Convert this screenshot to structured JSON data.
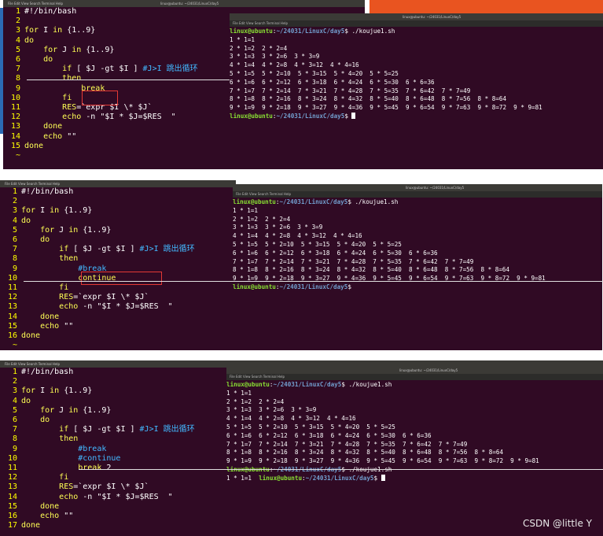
{
  "window": {
    "menu_items": [
      "File",
      "Edit",
      "View",
      "Search",
      "Terminal",
      "Help"
    ],
    "terminal_title": "linux@ubuntu: ~/24031/LinuxC/day5"
  },
  "panels": [
    {
      "lines": [
        {
          "n": "1",
          "parts": [
            {
              "c": "tx",
              "t": "#!/bin/bash"
            }
          ]
        },
        {
          "n": "2",
          "parts": []
        },
        {
          "n": "3",
          "parts": [
            {
              "c": "kw",
              "t": "for"
            },
            {
              "c": "tx",
              "t": " I "
            },
            {
              "c": "kw",
              "t": "in"
            },
            {
              "c": "tx",
              "t": " {1..9}"
            }
          ]
        },
        {
          "n": "4",
          "parts": [
            {
              "c": "kw",
              "t": "do"
            }
          ]
        },
        {
          "n": "5",
          "parts": [
            {
              "c": "tx",
              "t": "    "
            },
            {
              "c": "kw",
              "t": "for"
            },
            {
              "c": "tx",
              "t": " J "
            },
            {
              "c": "kw",
              "t": "in"
            },
            {
              "c": "tx",
              "t": " {1..9}"
            }
          ]
        },
        {
          "n": "6",
          "parts": [
            {
              "c": "tx",
              "t": "    "
            },
            {
              "c": "kw",
              "t": "do"
            }
          ]
        },
        {
          "n": "7",
          "parts": [
            {
              "c": "tx",
              "t": "        "
            },
            {
              "c": "kw",
              "t": "if"
            },
            {
              "c": "tx",
              "t": " [ $J -gt $I ] "
            },
            {
              "c": "cm",
              "t": "#J>I 跳出循环"
            }
          ]
        },
        {
          "n": "8",
          "parts": [
            {
              "c": "tx",
              "t": "        "
            },
            {
              "c": "kw",
              "t": "then"
            }
          ]
        },
        {
          "n": "9",
          "parts": [
            {
              "c": "tx",
              "t": "            "
            },
            {
              "c": "kw",
              "t": "break"
            }
          ]
        },
        {
          "n": "10",
          "parts": [
            {
              "c": "tx",
              "t": "        "
            },
            {
              "c": "kw",
              "t": "fi"
            }
          ]
        },
        {
          "n": "11",
          "parts": [
            {
              "c": "tx",
              "t": "        "
            },
            {
              "c": "kw",
              "t": "RES"
            },
            {
              "c": "tx",
              "t": "=`expr $I \\* $J`"
            }
          ]
        },
        {
          "n": "12",
          "parts": [
            {
              "c": "tx",
              "t": "        "
            },
            {
              "c": "kw",
              "t": "echo"
            },
            {
              "c": "tx",
              "t": " -n \"$I * $J=$RES  \""
            }
          ]
        },
        {
          "n": "13",
          "parts": [
            {
              "c": "tx",
              "t": "    "
            },
            {
              "c": "kw",
              "t": "done"
            }
          ]
        },
        {
          "n": "14",
          "parts": [
            {
              "c": "tx",
              "t": "    "
            },
            {
              "c": "kw",
              "t": "echo"
            },
            {
              "c": "tx",
              "t": " \"\""
            }
          ]
        },
        {
          "n": "15",
          "parts": [
            {
              "c": "kw",
              "t": "done"
            }
          ]
        },
        {
          "n": "~",
          "parts": []
        }
      ],
      "terminal": [
        {
          "prompt": true,
          "cmd": " ./koujue1.sh"
        },
        {
          "t": "1 * 1=1"
        },
        {
          "t": "2 * 1=2  2 * 2=4"
        },
        {
          "t": "3 * 1=3  3 * 2=6  3 * 3=9"
        },
        {
          "t": "4 * 1=4  4 * 2=8  4 * 3=12  4 * 4=16"
        },
        {
          "t": "5 * 1=5  5 * 2=10  5 * 3=15  5 * 4=20  5 * 5=25"
        },
        {
          "t": "6 * 1=6  6 * 2=12  6 * 3=18  6 * 4=24  6 * 5=30  6 * 6=36"
        },
        {
          "t": "7 * 1=7  7 * 2=14  7 * 3=21  7 * 4=28  7 * 5=35  7 * 6=42  7 * 7=49"
        },
        {
          "t": "8 * 1=8  8 * 2=16  8 * 3=24  8 * 4=32  8 * 5=40  8 * 6=48  8 * 7=56  8 * 8=64"
        },
        {
          "t": "9 * 1=9  9 * 2=18  9 * 3=27  9 * 4=36  9 * 5=45  9 * 6=54  9 * 7=63  9 * 8=72  9 * 9=81"
        },
        {
          "prompt": true,
          "cmd": " ",
          "cursor": true
        }
      ]
    },
    {
      "lines": [
        {
          "n": "1",
          "parts": [
            {
              "c": "tx",
              "t": "#!/bin/bash"
            }
          ]
        },
        {
          "n": "2",
          "parts": []
        },
        {
          "n": "3",
          "parts": [
            {
              "c": "kw",
              "t": "for"
            },
            {
              "c": "tx",
              "t": " I "
            },
            {
              "c": "kw",
              "t": "in"
            },
            {
              "c": "tx",
              "t": " {1..9}"
            }
          ]
        },
        {
          "n": "4",
          "parts": [
            {
              "c": "kw",
              "t": "do"
            }
          ]
        },
        {
          "n": "5",
          "parts": [
            {
              "c": "tx",
              "t": "    "
            },
            {
              "c": "kw",
              "t": "for"
            },
            {
              "c": "tx",
              "t": " J "
            },
            {
              "c": "kw",
              "t": "in"
            },
            {
              "c": "tx",
              "t": " {1..9}"
            }
          ]
        },
        {
          "n": "6",
          "parts": [
            {
              "c": "tx",
              "t": "    "
            },
            {
              "c": "kw",
              "t": "do"
            }
          ]
        },
        {
          "n": "7",
          "parts": [
            {
              "c": "tx",
              "t": "        "
            },
            {
              "c": "kw",
              "t": "if"
            },
            {
              "c": "tx",
              "t": " [ $J -gt $I ] "
            },
            {
              "c": "cm",
              "t": "#J>I 跳出循环"
            }
          ]
        },
        {
          "n": "8",
          "parts": [
            {
              "c": "tx",
              "t": "        "
            },
            {
              "c": "kw",
              "t": "then"
            }
          ]
        },
        {
          "n": "9",
          "parts": [
            {
              "c": "tx",
              "t": "            "
            },
            {
              "c": "cm",
              "t": "#break"
            }
          ]
        },
        {
          "n": "10",
          "parts": [
            {
              "c": "tx",
              "t": "            "
            },
            {
              "c": "kw",
              "t": "continue"
            }
          ]
        },
        {
          "n": "11",
          "parts": [
            {
              "c": "tx",
              "t": "        "
            },
            {
              "c": "kw",
              "t": "fi"
            }
          ]
        },
        {
          "n": "12",
          "parts": [
            {
              "c": "tx",
              "t": "        "
            },
            {
              "c": "kw",
              "t": "RES"
            },
            {
              "c": "tx",
              "t": "=`expr $I \\* $J`"
            }
          ]
        },
        {
          "n": "13",
          "parts": [
            {
              "c": "tx",
              "t": "        "
            },
            {
              "c": "kw",
              "t": "echo"
            },
            {
              "c": "tx",
              "t": " -n \"$I * $J=$RES  \""
            }
          ]
        },
        {
          "n": "14",
          "parts": [
            {
              "c": "tx",
              "t": "    "
            },
            {
              "c": "kw",
              "t": "done"
            }
          ]
        },
        {
          "n": "15",
          "parts": [
            {
              "c": "tx",
              "t": "    "
            },
            {
              "c": "kw",
              "t": "echo"
            },
            {
              "c": "tx",
              "t": " \"\""
            }
          ]
        },
        {
          "n": "16",
          "parts": [
            {
              "c": "kw",
              "t": "done"
            }
          ]
        },
        {
          "n": "~",
          "parts": []
        }
      ],
      "terminal": [
        {
          "prompt": true,
          "cmd": " ./koujue1.sh"
        },
        {
          "t": "1 * 1=1"
        },
        {
          "t": "2 * 1=2  2 * 2=4"
        },
        {
          "t": "3 * 1=3  3 * 2=6  3 * 3=9"
        },
        {
          "t": "4 * 1=4  4 * 2=8  4 * 3=12  4 * 4=16"
        },
        {
          "t": "5 * 1=5  5 * 2=10  5 * 3=15  5 * 4=20  5 * 5=25"
        },
        {
          "t": "6 * 1=6  6 * 2=12  6 * 3=18  6 * 4=24  6 * 5=30  6 * 6=36"
        },
        {
          "t": "7 * 1=7  7 * 2=14  7 * 3=21  7 * 4=28  7 * 5=35  7 * 6=42  7 * 7=49"
        },
        {
          "t": "8 * 1=8  8 * 2=16  8 * 3=24  8 * 4=32  8 * 5=40  8 * 6=48  8 * 7=56  8 * 8=64"
        },
        {
          "t": "9 * 1=9  9 * 2=18  9 * 3=27  9 * 4=36  9 * 5=45  9 * 6=54  9 * 7=63  9 * 8=72  9 * 9=81"
        },
        {
          "prompt": true,
          "cmd": " "
        }
      ]
    },
    {
      "lines": [
        {
          "n": "1",
          "parts": [
            {
              "c": "tx",
              "t": "#!/bin/bash"
            }
          ]
        },
        {
          "n": "2",
          "parts": []
        },
        {
          "n": "3",
          "parts": [
            {
              "c": "kw",
              "t": "for"
            },
            {
              "c": "tx",
              "t": " I "
            },
            {
              "c": "kw",
              "t": "in"
            },
            {
              "c": "tx",
              "t": " {1..9}"
            }
          ]
        },
        {
          "n": "4",
          "parts": [
            {
              "c": "kw",
              "t": "do"
            }
          ]
        },
        {
          "n": "5",
          "parts": [
            {
              "c": "tx",
              "t": "    "
            },
            {
              "c": "kw",
              "t": "for"
            },
            {
              "c": "tx",
              "t": " J "
            },
            {
              "c": "kw",
              "t": "in"
            },
            {
              "c": "tx",
              "t": " {1..9}"
            }
          ]
        },
        {
          "n": "6",
          "parts": [
            {
              "c": "tx",
              "t": "    "
            },
            {
              "c": "kw",
              "t": "do"
            }
          ]
        },
        {
          "n": "7",
          "parts": [
            {
              "c": "tx",
              "t": "        "
            },
            {
              "c": "kw",
              "t": "if"
            },
            {
              "c": "tx",
              "t": " [ $J -gt $I ] "
            },
            {
              "c": "cm",
              "t": "#J>I 跳出循环"
            }
          ]
        },
        {
          "n": "8",
          "parts": [
            {
              "c": "tx",
              "t": "        "
            },
            {
              "c": "kw",
              "t": "then"
            }
          ]
        },
        {
          "n": "9",
          "parts": [
            {
              "c": "tx",
              "t": "            "
            },
            {
              "c": "cm",
              "t": "#break"
            }
          ]
        },
        {
          "n": "10",
          "parts": [
            {
              "c": "tx",
              "t": "            "
            },
            {
              "c": "cm",
              "t": "#continue"
            }
          ]
        },
        {
          "n": "11",
          "parts": [
            {
              "c": "tx",
              "t": "            "
            },
            {
              "c": "kw",
              "t": "break"
            },
            {
              "c": "tx",
              "t": " 2"
            }
          ]
        },
        {
          "n": "12",
          "parts": [
            {
              "c": "tx",
              "t": "        "
            },
            {
              "c": "kw",
              "t": "fi"
            }
          ]
        },
        {
          "n": "13",
          "parts": [
            {
              "c": "tx",
              "t": "        "
            },
            {
              "c": "kw",
              "t": "RES"
            },
            {
              "c": "tx",
              "t": "=`expr $I \\* $J`"
            }
          ]
        },
        {
          "n": "14",
          "parts": [
            {
              "c": "tx",
              "t": "        "
            },
            {
              "c": "kw",
              "t": "echo"
            },
            {
              "c": "tx",
              "t": " -n \"$I * $J=$RES  \""
            }
          ]
        },
        {
          "n": "15",
          "parts": [
            {
              "c": "tx",
              "t": "    "
            },
            {
              "c": "kw",
              "t": "done"
            }
          ]
        },
        {
          "n": "16",
          "parts": [
            {
              "c": "tx",
              "t": "    "
            },
            {
              "c": "kw",
              "t": "echo"
            },
            {
              "c": "tx",
              "t": " \"\""
            }
          ]
        },
        {
          "n": "17",
          "parts": [
            {
              "c": "kw",
              "t": "done"
            }
          ]
        }
      ],
      "terminal": [
        {
          "prompt": true,
          "cmd": " ./koujue1.sh"
        },
        {
          "t": "1 * 1=1"
        },
        {
          "t": "2 * 1=2  2 * 2=4"
        },
        {
          "t": "3 * 1=3  3 * 2=6  3 * 3=9"
        },
        {
          "t": "4 * 1=4  4 * 2=8  4 * 3=12  4 * 4=16"
        },
        {
          "t": "5 * 1=5  5 * 2=10  5 * 3=15  5 * 4=20  5 * 5=25"
        },
        {
          "t": "6 * 1=6  6 * 2=12  6 * 3=18  6 * 4=24  6 * 5=30  6 * 6=36"
        },
        {
          "t": "7 * 1=7  7 * 2=14  7 * 3=21  7 * 4=28  7 * 5=35  7 * 6=42  7 * 7=49"
        },
        {
          "t": "8 * 1=8  8 * 2=16  8 * 3=24  8 * 4=32  8 * 5=40  8 * 6=48  8 * 7=56  8 * 8=64"
        },
        {
          "t": "9 * 1=9  9 * 2=18  9 * 3=27  9 * 4=36  9 * 5=45  9 * 6=54  9 * 7=63  9 * 8=72  9 * 9=81"
        },
        {
          "prompt": true,
          "cmd": " ./koujue1.sh"
        },
        {
          "t": "1 * 1=1  ",
          "prompt_after": true,
          "cursor": true
        }
      ]
    }
  ],
  "prompt": {
    "user": "linux@ubuntu",
    "sep": ":",
    "path": "~/24031/LinuxC/day5",
    "end": "$"
  },
  "watermark": "CSDN @little Y",
  "colors": {
    "terminal_bg": "#300a24",
    "keyword": "#ffff55",
    "comment": "#42b8ff",
    "prompt_user": "#8ae234",
    "prompt_path": "#729fcf",
    "highlight_box": "#e53935"
  }
}
